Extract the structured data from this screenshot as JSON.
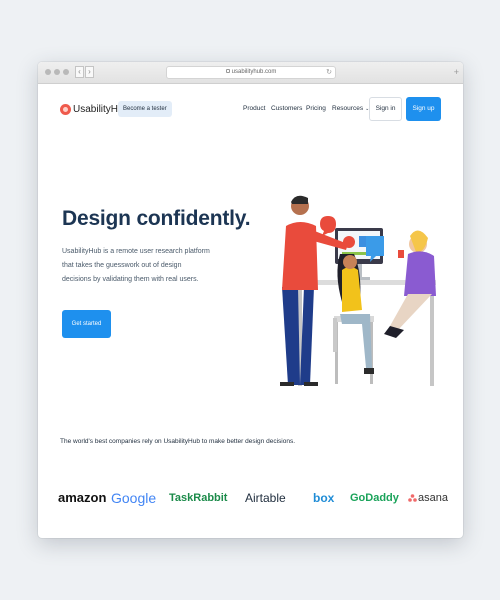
{
  "browser": {
    "url": "usabilityhub.com",
    "back_glyph": "‹",
    "forward_glyph": "›",
    "reload_glyph": "↻",
    "newtab_glyph": "+"
  },
  "header": {
    "logo_text": "UsabilityHub",
    "tester_button": "Become a tester",
    "nav": [
      {
        "label": "Product"
      },
      {
        "label": "Customers"
      },
      {
        "label": "Pricing"
      },
      {
        "label": "Resources",
        "chevron": "⌄"
      }
    ],
    "sign_in": "Sign in",
    "sign_up": "Sign up"
  },
  "hero": {
    "headline": "Design confidently.",
    "body": "UsabilityHub is a remote user research platform that takes the guesswork out of design decisions by validating them with real users.",
    "cta": "Get started"
  },
  "trust": {
    "text": "The world's best companies rely on UsabilityHub to make better design decisions.",
    "logos": [
      "amazon",
      "Google",
      "TaskRabbit",
      "Airtable",
      "box",
      "GoDaddy",
      "asana"
    ]
  },
  "colors": {
    "accent": "#1e90ee",
    "headline": "#1c3553",
    "logo_red": "#ef5a4c"
  },
  "icons": {
    "logo": "usabilityhub-logo-icon",
    "lock": "lock-icon",
    "chevron": "chevron-down-icon"
  }
}
